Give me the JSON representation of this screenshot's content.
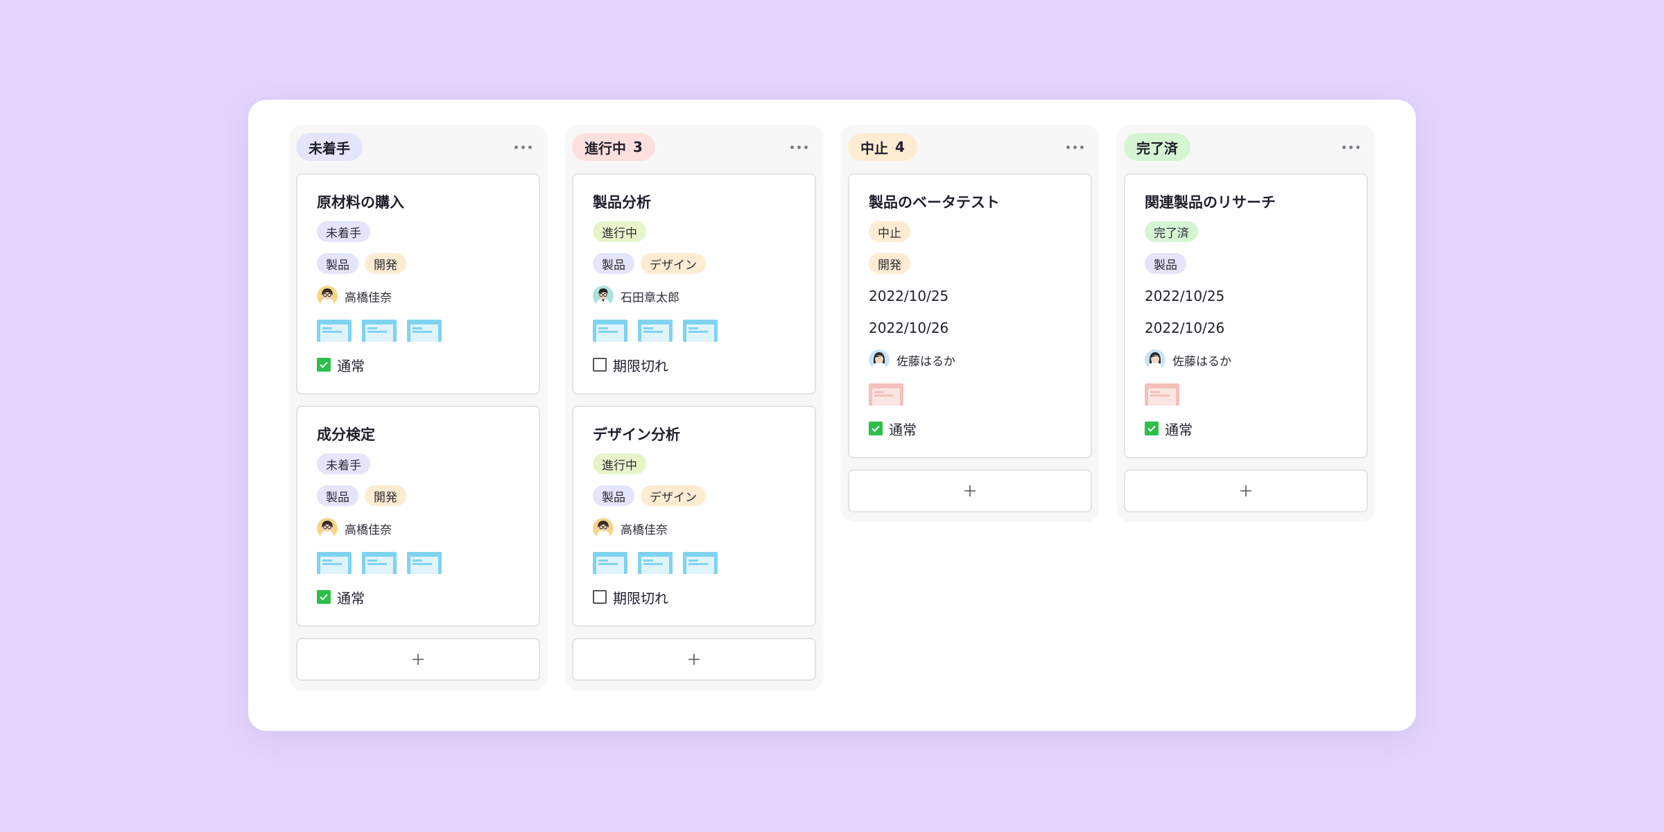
{
  "colors": {
    "page_bg": "#e2d4fb",
    "tag_blue": "#e4e5fb",
    "tag_orange": "#fdecd2",
    "tag_green_light": "#e6f5c8",
    "tag_red": "#fde0dd",
    "tag_green": "#d5f5d2",
    "check_green": "#2dbf4a",
    "thumb_blue": "#7fd3ef",
    "thumb_pink": "#f3c0bb"
  },
  "columns": [
    {
      "title": "未着手",
      "count": "",
      "pill_color": "#e4e5fb",
      "cards": [
        {
          "title": "原材料の購入",
          "status_tag": {
            "label": "未着手",
            "color": "#e4e5fb"
          },
          "tags": [
            {
              "label": "製品",
              "color": "#e4e5fb"
            },
            {
              "label": "開発",
              "color": "#fdecd2"
            }
          ],
          "assignee": "高橋佳奈",
          "avatar": "woman-glasses",
          "thumbs": [
            "blue",
            "blue",
            "blue"
          ],
          "checked": true,
          "status_label": "通常"
        },
        {
          "title": "成分検定",
          "status_tag": {
            "label": "未着手",
            "color": "#e4e5fb"
          },
          "tags": [
            {
              "label": "製品",
              "color": "#e4e5fb"
            },
            {
              "label": "開発",
              "color": "#fdecd2"
            }
          ],
          "assignee": "高橋佳奈",
          "avatar": "woman-glasses",
          "thumbs": [
            "blue",
            "blue",
            "blue"
          ],
          "checked": true,
          "status_label": "通常"
        }
      ]
    },
    {
      "title": "進行中",
      "count": "3",
      "pill_color": "#fde0dd",
      "cards": [
        {
          "title": "製品分析",
          "status_tag": {
            "label": "進行中",
            "color": "#e6f5c8"
          },
          "tags": [
            {
              "label": "製品",
              "color": "#e4e5fb"
            },
            {
              "label": "デザイン",
              "color": "#fdecd2"
            }
          ],
          "assignee": "石田章太郎",
          "avatar": "man-glasses",
          "thumbs": [
            "blue",
            "blue",
            "blue"
          ],
          "checked": false,
          "status_label": "期限切れ"
        },
        {
          "title": "デザイン分析",
          "status_tag": {
            "label": "進行中",
            "color": "#e6f5c8"
          },
          "tags": [
            {
              "label": "製品",
              "color": "#e4e5fb"
            },
            {
              "label": "デザイン",
              "color": "#fdecd2"
            }
          ],
          "assignee": "高橋佳奈",
          "avatar": "woman-glasses",
          "thumbs": [
            "blue",
            "blue",
            "blue"
          ],
          "checked": false,
          "status_label": "期限切れ"
        }
      ]
    },
    {
      "title": "中止",
      "count": "4",
      "pill_color": "#fdecd2",
      "cards": [
        {
          "title": "製品のベータテスト",
          "status_tag": {
            "label": "中止",
            "color": "#fdecd2"
          },
          "tags": [
            {
              "label": "開発",
              "color": "#fdecd2"
            }
          ],
          "dates": [
            "2022/10/25",
            "2022/10/26"
          ],
          "assignee": "佐藤はるか",
          "avatar": "woman",
          "thumbs": [
            "pink"
          ],
          "checked": true,
          "status_label": "通常"
        }
      ]
    },
    {
      "title": "完了済",
      "count": "",
      "pill_color": "#d5f5d2",
      "cards": [
        {
          "title": "関連製品のリサーチ",
          "status_tag": {
            "label": "完了済",
            "color": "#d5f5d2"
          },
          "tags": [
            {
              "label": "製品",
              "color": "#e4e5fb"
            }
          ],
          "dates": [
            "2022/10/25",
            "2022/10/26"
          ],
          "assignee": "佐藤はるか",
          "avatar": "woman",
          "thumbs": [
            "pink"
          ],
          "checked": true,
          "status_label": "通常"
        }
      ]
    }
  ],
  "add_label": "+"
}
